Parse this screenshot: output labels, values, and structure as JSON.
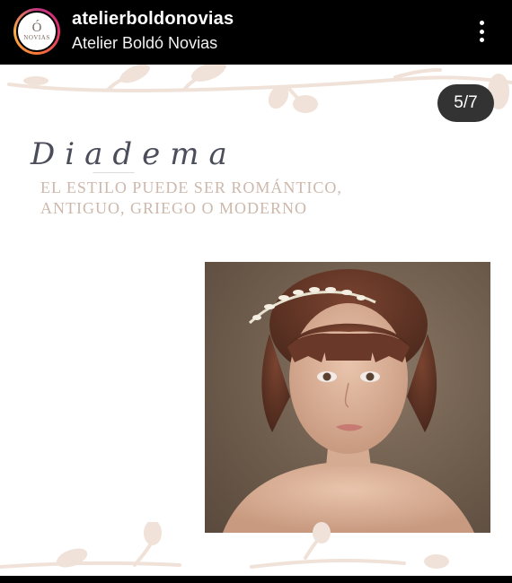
{
  "header": {
    "username": "atelierboldonovias",
    "display_name": "Atelier Boldó Novias",
    "avatar_letter": "Ó",
    "avatar_text": "NOVIAS"
  },
  "post": {
    "counter": "5/7",
    "script_title": "Diadema",
    "tagline": "El estilo puede ser romántico, antiguo, griego o moderno"
  },
  "colors": {
    "background": "#ffffff",
    "tagline": "#cdb8ab",
    "script": "#4b4d5a",
    "counter_bg": "#333333",
    "deco": "#f0e2d8"
  },
  "icons": [
    "more-options-icon"
  ]
}
